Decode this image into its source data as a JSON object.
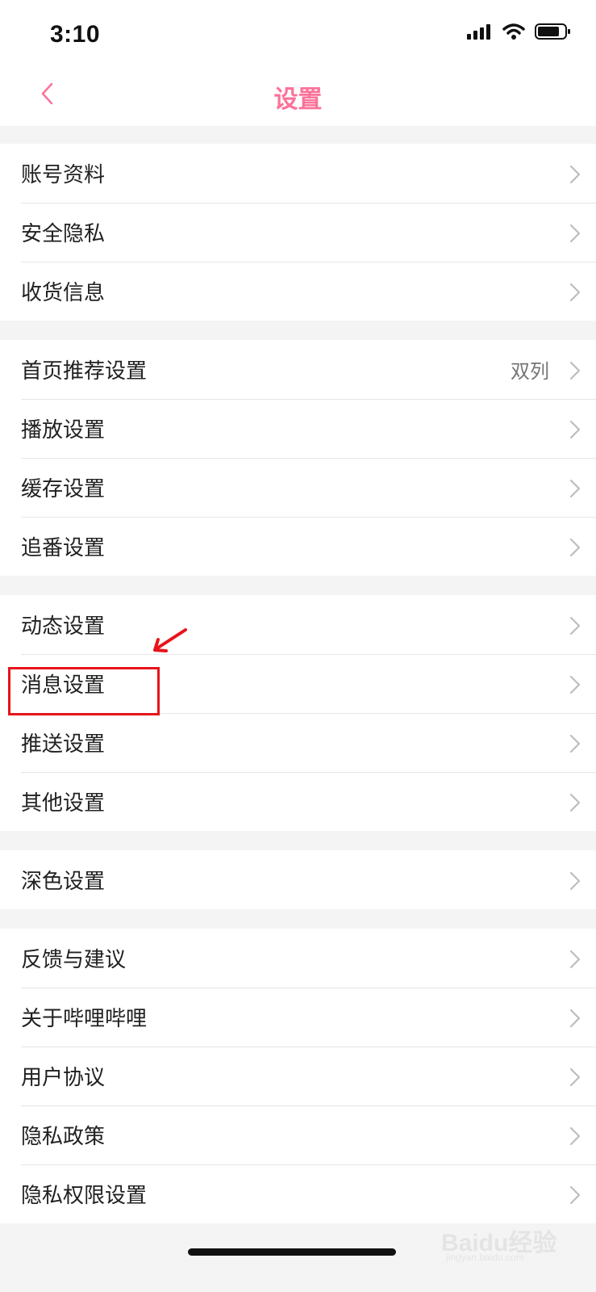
{
  "status_bar": {
    "time": "3:10"
  },
  "header": {
    "title": "设置"
  },
  "groups": [
    {
      "items": [
        {
          "label": "账号资料"
        },
        {
          "label": "安全隐私"
        },
        {
          "label": "收货信息"
        }
      ]
    },
    {
      "items": [
        {
          "label": "首页推荐设置",
          "value": "双列"
        },
        {
          "label": "播放设置"
        },
        {
          "label": "缓存设置"
        },
        {
          "label": "追番设置"
        }
      ]
    },
    {
      "items": [
        {
          "label": "动态设置"
        },
        {
          "label": "消息设置"
        },
        {
          "label": "推送设置"
        },
        {
          "label": "其他设置"
        }
      ]
    },
    {
      "items": [
        {
          "label": "深色设置"
        }
      ]
    },
    {
      "items": [
        {
          "label": "反馈与建议"
        },
        {
          "label": "关于哔哩哔哩"
        },
        {
          "label": "用户协议"
        },
        {
          "label": "隐私政策"
        },
        {
          "label": "隐私权限设置"
        }
      ]
    }
  ],
  "watermark": {
    "brand": "Baidu经验",
    "url": "jingyan.baidu.com"
  },
  "colors": {
    "accent": "#fb7299",
    "annotation": "#e8141b"
  }
}
